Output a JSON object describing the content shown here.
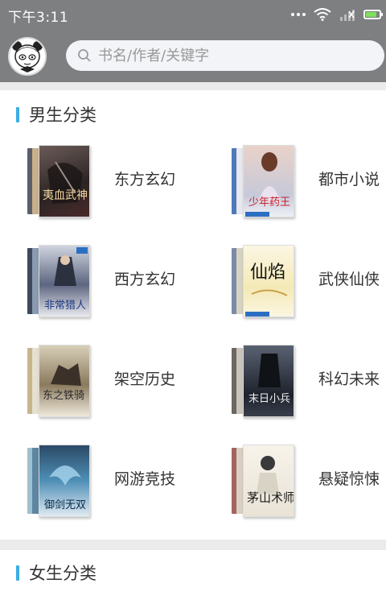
{
  "status_bar": {
    "time": "下午3:11",
    "icons": [
      "wifi-icon",
      "signal-icon",
      "battery-icon"
    ]
  },
  "header": {
    "avatar_icon": "panda-avatar-icon",
    "search_placeholder": "书名/作者/关键字"
  },
  "sections": [
    {
      "title": "男生分类",
      "categories": [
        {
          "label": "东方玄幻",
          "cover_text": "夷血武神",
          "cover_color": "#3a2f2f"
        },
        {
          "label": "都市小说",
          "cover_text": "少年药王",
          "cover_color": "#d7dbe6"
        },
        {
          "label": "西方玄幻",
          "cover_text": "非常猎人",
          "cover_color": "#4b4f63"
        },
        {
          "label": "武侠仙侠",
          "cover_text": "仙焰",
          "cover_color": "#f0e4b8"
        },
        {
          "label": "架空历史",
          "cover_text": "东之铁骑",
          "cover_color": "#6b5a44"
        },
        {
          "label": "科幻未来",
          "cover_text": "末日小兵",
          "cover_color": "#2f3540"
        },
        {
          "label": "网游竞技",
          "cover_text": "御剑无双",
          "cover_color": "#2f5a78"
        },
        {
          "label": "悬疑惊悚",
          "cover_text": "茅山术师",
          "cover_color": "#efeae0"
        }
      ]
    },
    {
      "title": "女生分类"
    }
  ],
  "accent_color": "#3aaee4"
}
